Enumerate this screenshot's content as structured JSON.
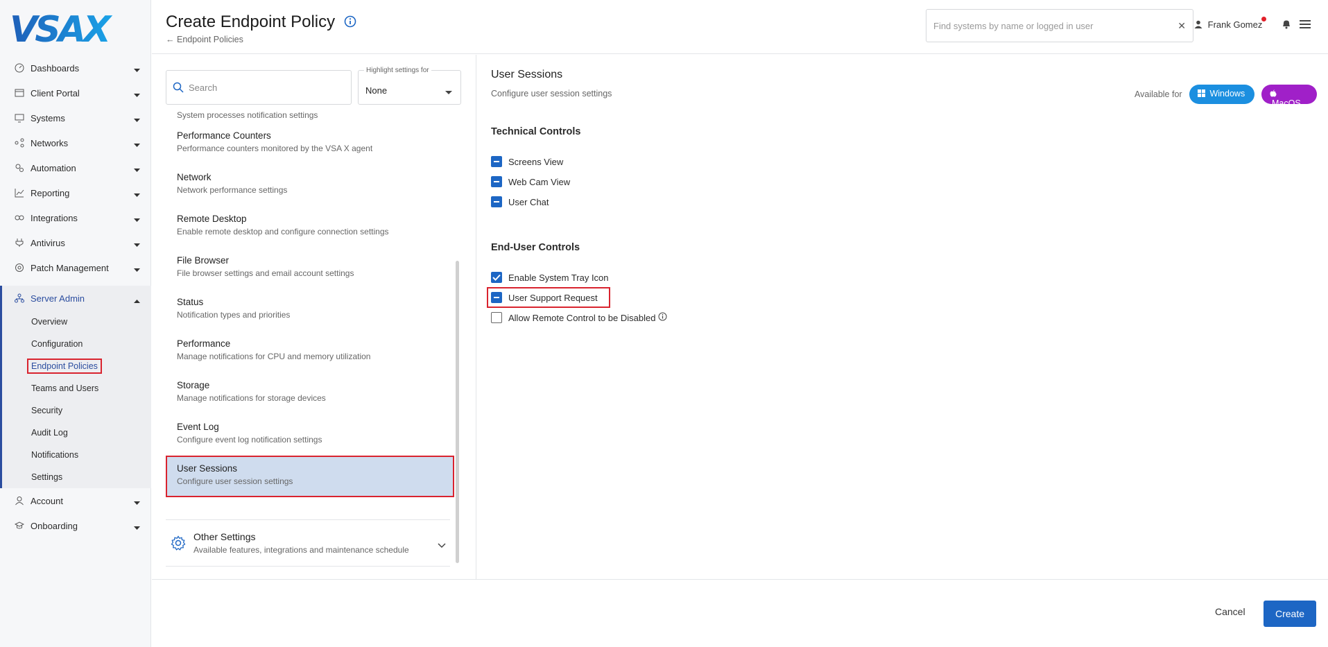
{
  "sidebar": {
    "logo_text": "VSAX",
    "items": [
      {
        "label": "Dashboards",
        "icon": "dashboard-icon"
      },
      {
        "label": "Client Portal",
        "icon": "client-portal-icon"
      },
      {
        "label": "Systems",
        "icon": "monitor-icon"
      },
      {
        "label": "Networks",
        "icon": "network-icon"
      },
      {
        "label": "Automation",
        "icon": "automation-icon"
      },
      {
        "label": "Reporting",
        "icon": "chart-icon"
      },
      {
        "label": "Integrations",
        "icon": "integrations-icon"
      },
      {
        "label": "Antivirus",
        "icon": "antivirus-icon"
      },
      {
        "label": "Patch Management",
        "icon": "patch-icon"
      }
    ],
    "server_admin": {
      "label": "Server Admin",
      "sub": [
        "Overview",
        "Configuration",
        "Endpoint Policies",
        "Teams and Users",
        "Security",
        "Audit Log",
        "Notifications",
        "Settings"
      ],
      "active": "Endpoint Policies"
    },
    "bottom": [
      {
        "label": "Account",
        "icon": "user-icon"
      },
      {
        "label": "Onboarding",
        "icon": "onboarding-icon"
      }
    ]
  },
  "header": {
    "title": "Create Endpoint Policy",
    "breadcrumb": "Endpoint Policies",
    "search_placeholder": "Find systems by name or logged in user",
    "user_name": "Frank Gomez"
  },
  "left_panel": {
    "search_placeholder": "Search",
    "highlight_label": "Highlight settings for",
    "highlight_value": "None",
    "items": [
      {
        "title": "",
        "desc": "System processes notification settings"
      },
      {
        "title": "Performance Counters",
        "desc": "Performance counters monitored by the VSA X agent"
      },
      {
        "title": "Network",
        "desc": "Network performance settings"
      },
      {
        "title": "Remote Desktop",
        "desc": "Enable remote desktop and configure connection settings"
      },
      {
        "title": "File Browser",
        "desc": "File browser settings and email account settings"
      },
      {
        "title": "Status",
        "desc": "Notification types and priorities"
      },
      {
        "title": "Performance",
        "desc": "Manage notifications for CPU and memory utilization"
      },
      {
        "title": "Storage",
        "desc": "Manage notifications for storage devices"
      },
      {
        "title": "Event Log",
        "desc": "Configure event log notification settings"
      },
      {
        "title": "User Sessions",
        "desc": "Configure user session settings"
      }
    ],
    "other": {
      "title": "Other Settings",
      "desc": "Available features, integrations and maintenance schedule"
    }
  },
  "right_panel": {
    "title": "User Sessions",
    "desc": "Configure user session settings",
    "available_for": "Available for",
    "badges": [
      {
        "label": "Windows",
        "color": "#1b8fe0"
      },
      {
        "label": "MacOS",
        "color": "#a020c8"
      }
    ],
    "technical": {
      "title": "Technical Controls",
      "items": [
        {
          "label": "Screens View",
          "state": "indeterminate"
        },
        {
          "label": "Web Cam View",
          "state": "indeterminate"
        },
        {
          "label": "User Chat",
          "state": "indeterminate"
        }
      ]
    },
    "enduser": {
      "title": "End-User Controls",
      "items": [
        {
          "label": "Enable System Tray Icon",
          "state": "checked"
        },
        {
          "label": "User Support Request",
          "state": "indeterminate"
        },
        {
          "label": "Allow Remote Control to be Disabled",
          "state": "unchecked"
        }
      ]
    }
  },
  "footer": {
    "cancel": "Cancel",
    "create": "Create"
  },
  "colors": {
    "accent": "#1d66c4",
    "highlight": "#d9232e",
    "nav_active": "#2b4d9f"
  }
}
